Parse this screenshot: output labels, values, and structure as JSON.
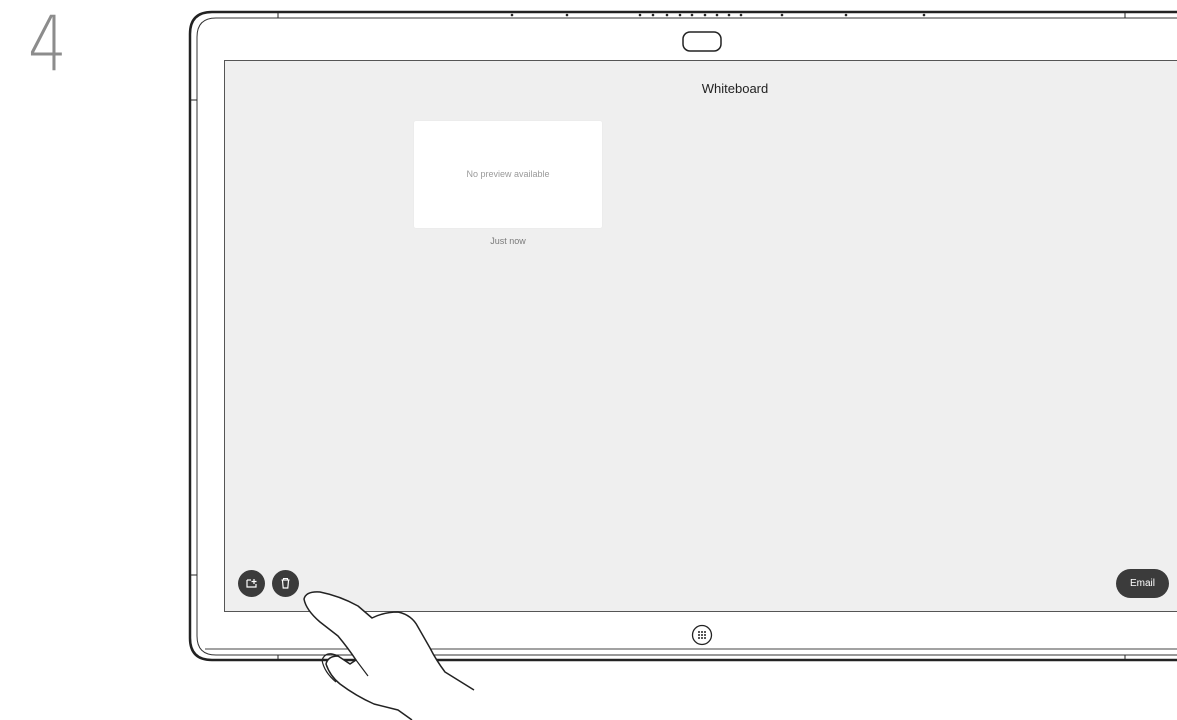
{
  "step": {
    "number": "4"
  },
  "screen": {
    "title": "Whiteboard",
    "thumbnail": {
      "preview_text": "No preview available",
      "timestamp": "Just now"
    },
    "actions": {
      "share_icon": "share-icon",
      "delete_icon": "trash-icon",
      "email_label": "Email"
    }
  },
  "device": {
    "home_icon": "keypad-grid-icon",
    "camera": "camera-icon"
  },
  "colors": {
    "screen_bg": "#efefef",
    "button_dark": "#3b3b3b",
    "bezel": "#222222"
  }
}
